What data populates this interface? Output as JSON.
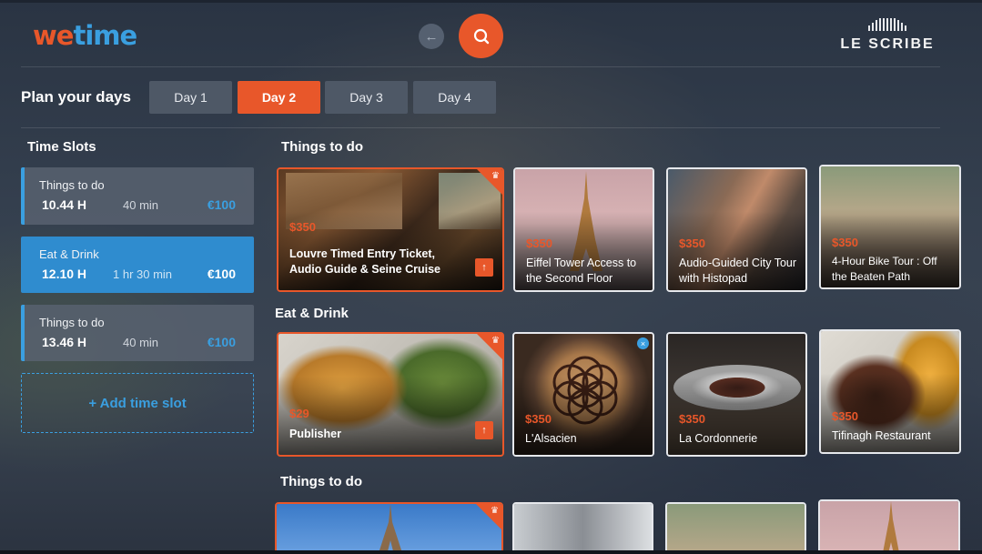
{
  "header": {
    "logo_we": "we",
    "logo_time": "time",
    "brand": "LE SCRIBE"
  },
  "plan": {
    "title": "Plan your days",
    "days": [
      "Day 1",
      "Day 2",
      "Day 3",
      "Day 4"
    ],
    "active_day": "Day 2"
  },
  "time_slots": {
    "title": "Time Slots",
    "slots": [
      {
        "category": "Things to do",
        "time": "10.44 H",
        "duration": "40 min",
        "price": "€100"
      },
      {
        "category": "Eat & Drink",
        "time": "12.10 H",
        "duration": "1 hr 30 min",
        "price": "€100"
      },
      {
        "category": "Things to do",
        "time": "13.46 H",
        "duration": "40 min",
        "price": "€100"
      }
    ],
    "add_label": "+ Add time slot"
  },
  "sections": [
    {
      "title": "Things to do",
      "cards": [
        {
          "price": "$350",
          "title": "Louvre Timed Entry Ticket, Audio Guide & Seine Cruise"
        },
        {
          "price": "$350",
          "title": "Eiffel Tower Access to the Second Floor"
        },
        {
          "price": "$350",
          "title": "Audio-Guided City Tour with Histopad"
        },
        {
          "price": "$350",
          "title": "4-Hour Bike Tour : Off the Beaten Path"
        }
      ]
    },
    {
      "title": "Eat & Drink",
      "cards": [
        {
          "price": "$29",
          "title": "Publisher"
        },
        {
          "price": "$350",
          "title": "L'Alsacien"
        },
        {
          "price": "$350",
          "title": "La Cordonnerie"
        },
        {
          "price": "$350",
          "title": "Tifinagh Restaurant"
        }
      ]
    },
    {
      "title": "Things to do",
      "cards": []
    }
  ],
  "colors": {
    "accent": "#e8572a",
    "blue": "#3a9fe0"
  },
  "icons": {
    "back": "arrow-left-icon",
    "search": "search-icon",
    "featured": "crown-icon",
    "open": "arrow-up-icon"
  }
}
